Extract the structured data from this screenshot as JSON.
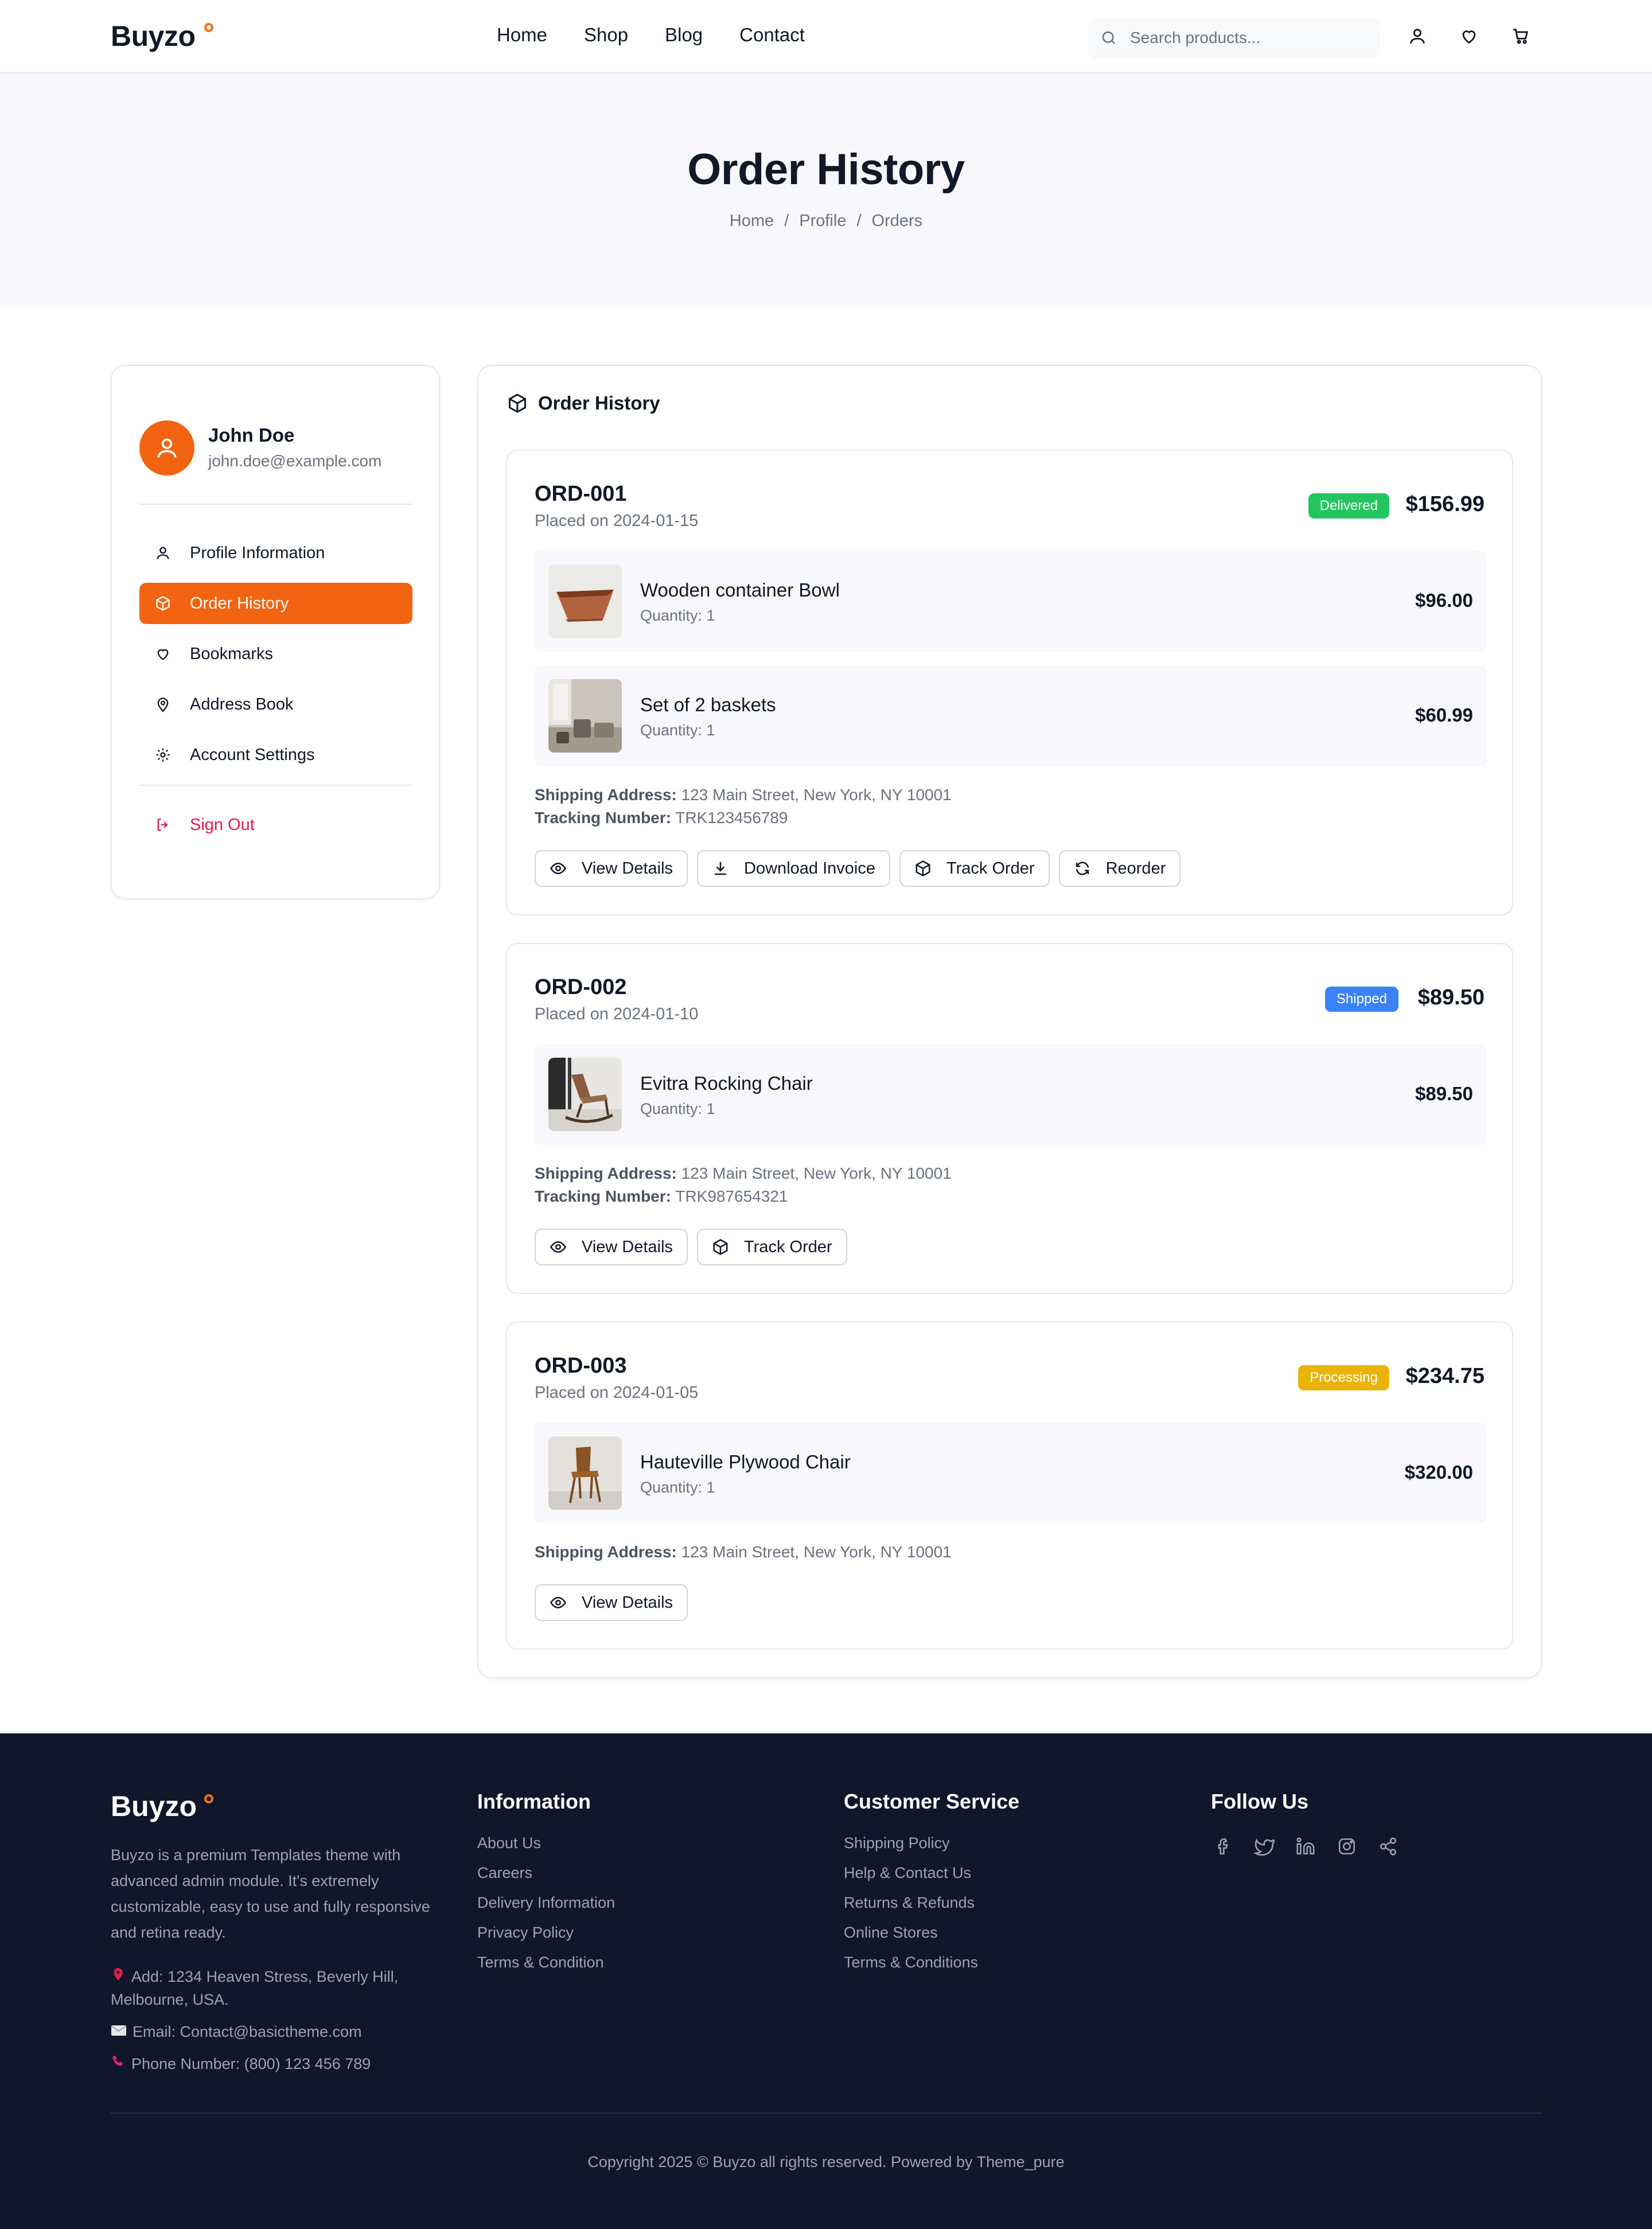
{
  "brand": "Buyzo",
  "nav": [
    "Home",
    "Shop",
    "Blog",
    "Contact"
  ],
  "search": {
    "placeholder": "Search products..."
  },
  "header_icons": [
    "user-icon",
    "heart-icon",
    "cart-icon"
  ],
  "hero": {
    "title": "Order History",
    "breadcrumb": [
      "Home",
      "Profile",
      "Orders"
    ]
  },
  "profile": {
    "name": "John Doe",
    "email": "john.doe@example.com"
  },
  "menu": [
    {
      "label": "Profile Information",
      "icon": "user-icon"
    },
    {
      "label": "Order History",
      "icon": "package-icon",
      "active": true
    },
    {
      "label": "Bookmarks",
      "icon": "heart-icon"
    },
    {
      "label": "Address Book",
      "icon": "map-pin-icon"
    },
    {
      "label": "Account Settings",
      "icon": "gear-icon"
    }
  ],
  "signout": "Sign Out",
  "panel_title": "Order History",
  "orders": [
    {
      "id": "ORD-001",
      "date": "Placed on 2024-01-15",
      "status": "Delivered",
      "status_color": "#22c55e",
      "total": "$156.99",
      "items": [
        {
          "name": "Wooden container Bowl",
          "qty": "Quantity: 1",
          "price": "$96.00"
        },
        {
          "name": "Set of 2 baskets",
          "qty": "Quantity: 1",
          "price": "$60.99"
        }
      ],
      "shipping_label": "Shipping Address:",
      "shipping": "123 Main Street, New York, NY 10001",
      "tracking_label": "Tracking Number:",
      "tracking": "TRK123456789",
      "buttons": [
        "View Details",
        "Download Invoice",
        "Track Order",
        "Reorder"
      ]
    },
    {
      "id": "ORD-002",
      "date": "Placed on 2024-01-10",
      "status": "Shipped",
      "status_color": "#3b82f6",
      "total": "$89.50",
      "items": [
        {
          "name": "Evitra Rocking Chair",
          "qty": "Quantity: 1",
          "price": "$89.50"
        }
      ],
      "shipping_label": "Shipping Address:",
      "shipping": "123 Main Street, New York, NY 10001",
      "tracking_label": "Tracking Number:",
      "tracking": "TRK987654321",
      "buttons": [
        "View Details",
        "Track Order"
      ]
    },
    {
      "id": "ORD-003",
      "date": "Placed on 2024-01-05",
      "status": "Processing",
      "status_color": "#eab308",
      "total": "$234.75",
      "items": [
        {
          "name": "Hauteville Plywood Chair",
          "qty": "Quantity: 1",
          "price": "$320.00"
        }
      ],
      "shipping_label": "Shipping Address:",
      "shipping": "123 Main Street, New York, NY 10001",
      "buttons": [
        "View Details"
      ]
    }
  ],
  "footer": {
    "brand": "Buyzo",
    "description": "Buyzo is a premium Templates theme with advanced admin module. It's extremely customizable, easy to use and fully responsive and retina ready.",
    "address": "Add: 1234 Heaven Stress, Beverly Hill, Melbourne, USA.",
    "email": "Email: Contact@basictheme.com",
    "phone": "Phone Number: (800) 123 456 789",
    "information": {
      "title": "Information",
      "links": [
        "About Us",
        "Careers",
        "Delivery Information",
        "Privacy Policy",
        "Terms & Condition"
      ]
    },
    "service": {
      "title": "Customer Service",
      "links": [
        "Shipping Policy",
        "Help & Contact Us",
        "Returns & Refunds",
        "Online Stores",
        "Terms & Conditions"
      ]
    },
    "follow": {
      "title": "Follow Us",
      "icons": [
        "facebook-icon",
        "twitter-icon",
        "linkedin-icon",
        "instagram-icon",
        "share-icon"
      ]
    },
    "copyright": "Copyright 2025 © Buyzo all rights reserved. Powered by Theme_pure"
  },
  "colors": {
    "accent": "#f26411",
    "footer_bg": "#11172b",
    "signout": "#e11d48"
  }
}
